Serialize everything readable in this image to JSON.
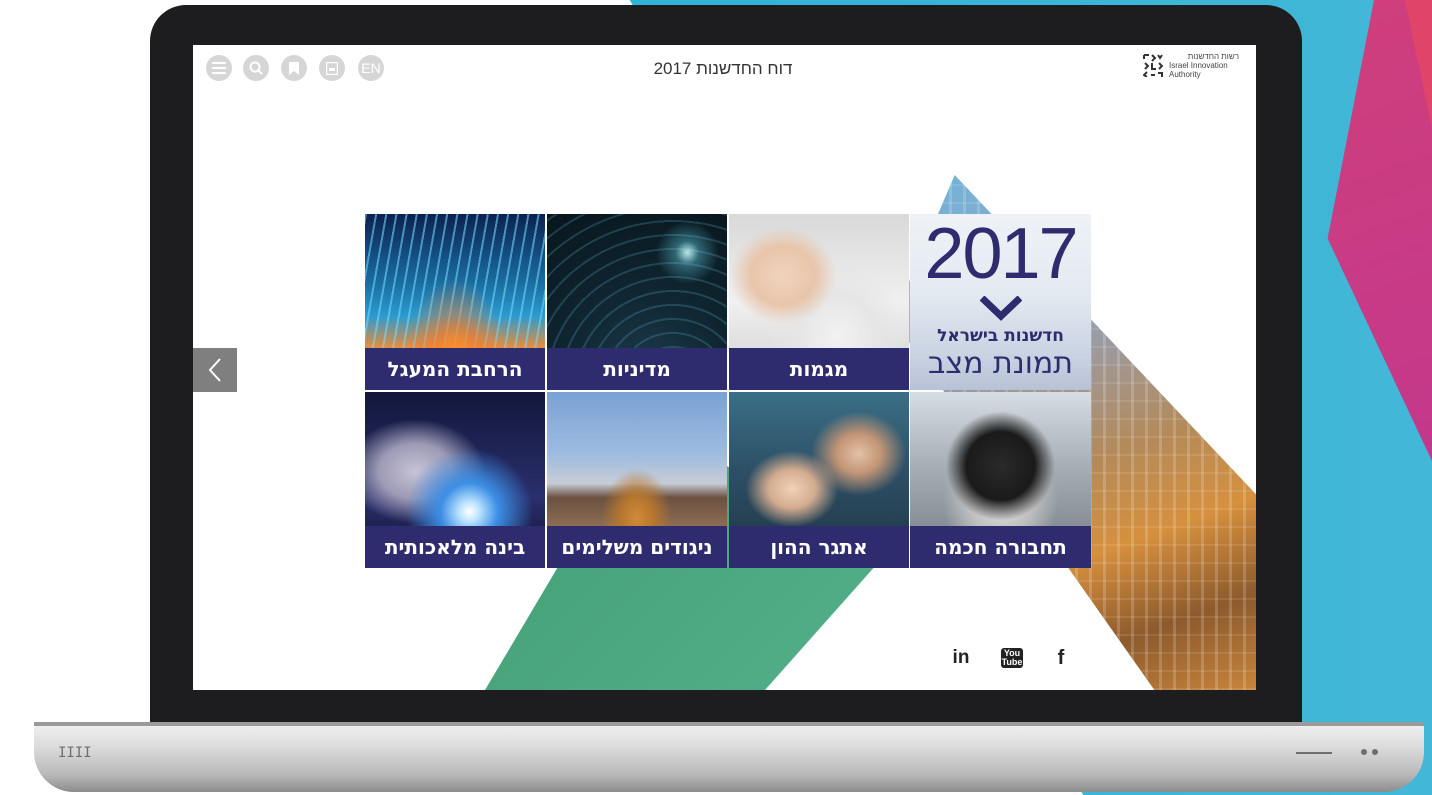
{
  "header": {
    "title": "דוח החדשנות 2017",
    "toolbar": [
      {
        "name": "menu-button",
        "icon": "menu-icon",
        "label": ""
      },
      {
        "name": "search-button",
        "icon": "search-icon",
        "label": ""
      },
      {
        "name": "bookmark-button",
        "icon": "bookmark-icon",
        "label": ""
      },
      {
        "name": "pdf-button",
        "icon": "pdf-icon",
        "label": ""
      },
      {
        "name": "language-button",
        "icon": "",
        "label": "EN"
      }
    ],
    "logo": {
      "line1": "רשות החדשנות",
      "line2": "Israel Innovation",
      "line3": "Authority"
    }
  },
  "cover": {
    "year": "2017",
    "subtitle1": "חדשנות בישראל",
    "subtitle2": "תמונת מצב"
  },
  "tiles": [
    {
      "label": "מגמות",
      "image": "business-meeting-photo"
    },
    {
      "label": "מדיניות",
      "image": "digital-globe-photo"
    },
    {
      "label": "הרחבת המעגל",
      "image": "city-light-trails-photo"
    },
    {
      "label": "תחבורה חכמה",
      "image": "robot-photo"
    },
    {
      "label": "אתגר ההון",
      "image": "office-team-photo"
    },
    {
      "label": "ניגודים משלימים",
      "image": "korean-palace-photo"
    },
    {
      "label": "בינה מלאכותית",
      "image": "robot-hand-photo"
    }
  ],
  "navigation": {
    "prev_icon": "chevron-left-icon"
  },
  "social": [
    {
      "name": "facebook",
      "label": "f"
    },
    {
      "name": "youtube",
      "label": "You Tube"
    },
    {
      "name": "linkedin",
      "label": "in"
    }
  ],
  "colors": {
    "tile_label_bg": "#2e2c6f",
    "toolbar_icon_bg": "#d6d6d6",
    "accent_green": "#4aa57c",
    "backdrop_blue": "#2db3d8",
    "backdrop_pink": "#c4388b"
  }
}
